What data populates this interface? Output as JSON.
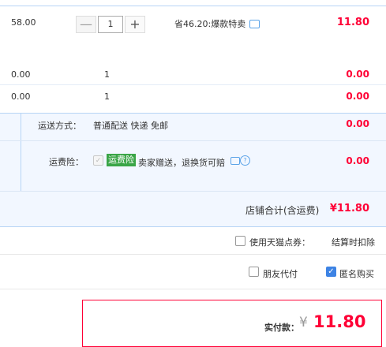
{
  "item1": {
    "price": "58.00",
    "quantity": "1",
    "minus_label": "—",
    "plus_label": "+",
    "promo": "省46.20:爆款特卖",
    "subtotal": "11.80"
  },
  "item2": {
    "price": "0.00",
    "quantity": "1",
    "subtotal": "0.00"
  },
  "item3": {
    "price": "0.00",
    "quantity": "1",
    "subtotal": "0.00"
  },
  "shipping": {
    "label": "运送方式：",
    "options": "普通配送 快递 免邮",
    "fee": "0.00"
  },
  "insurance": {
    "label": "运费险：",
    "tag": "运费险",
    "desc": "卖家赠送，退换货可赔",
    "fee": "0.00"
  },
  "store_total": {
    "label": "店铺合计(含运费)",
    "value": "¥11.80"
  },
  "coupon": {
    "label": "使用天猫点券：",
    "note": "结算时扣除"
  },
  "options": {
    "friend_pay": "朋友代付",
    "anonymous": "匿名购买"
  },
  "payment": {
    "label": "实付款：",
    "currency": "¥",
    "amount": "11.80"
  },
  "colors": {
    "accent_red": "#ff0036",
    "blue_bg": "#f2f7ff",
    "checkbox_blue": "#3d83e4",
    "tag_green": "#3aa547"
  },
  "icons": [
    "chat-bubble-icon",
    "question-circle-icon",
    "checkmark-icon"
  ]
}
